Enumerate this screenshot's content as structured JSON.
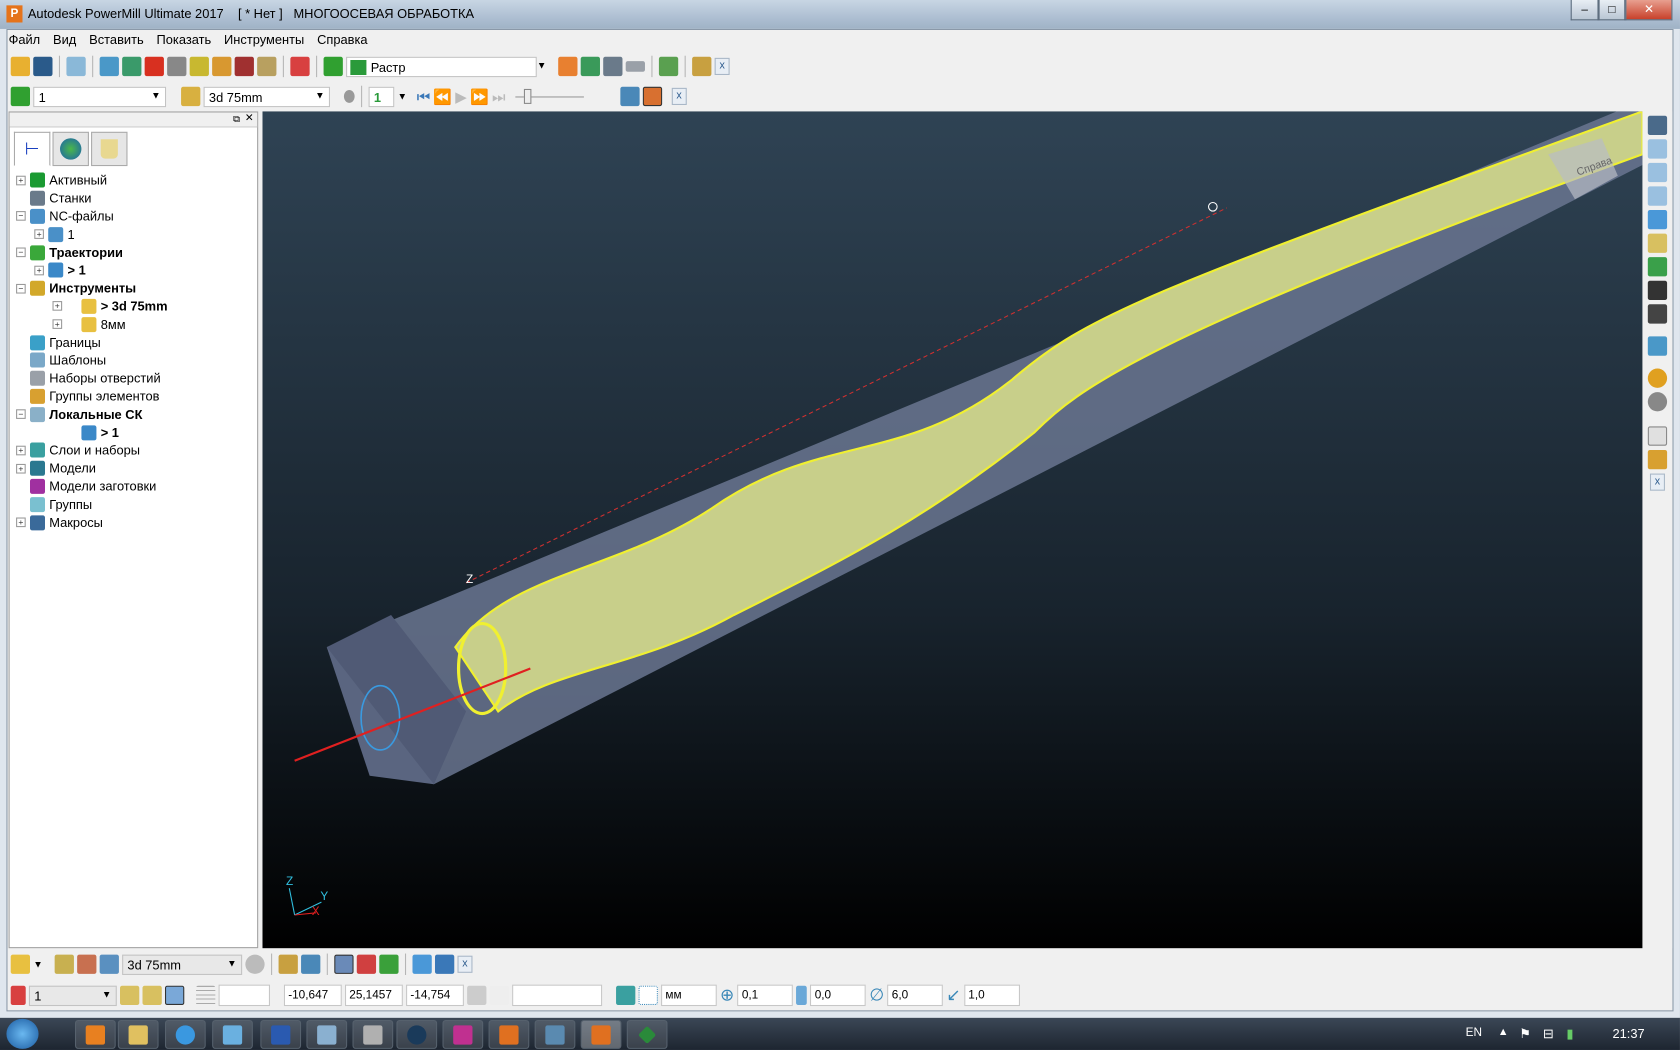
{
  "window": {
    "title": "Autodesk PowerMill Ultimate 2017",
    "project": "[ * Нет ]",
    "mode": "МНОГООСЕВАЯ ОБРАБОТКА"
  },
  "menu": [
    "Файл",
    "Вид",
    "Вставить",
    "Показать",
    "Инструменты",
    "Справка"
  ],
  "toolbar1": {
    "strategy_combo": "Растр"
  },
  "toolbar2": {
    "toolpath_combo": "1",
    "tool_combo": "3d 75mm",
    "step_value": "1"
  },
  "tree": [
    {
      "label": "Активный",
      "bold": false,
      "level": 0,
      "pm": "+",
      "color": "#1a9a32"
    },
    {
      "label": "Станки",
      "bold": false,
      "level": 0,
      "pm": "",
      "color": "#6a7a8a"
    },
    {
      "label": "NC-файлы",
      "bold": false,
      "level": 0,
      "pm": "-",
      "color": "#4a90c8"
    },
    {
      "label": "1",
      "bold": false,
      "level": 1,
      "pm": "+",
      "color": "#4a90c8"
    },
    {
      "label": "Траектории",
      "bold": true,
      "level": 0,
      "pm": "-",
      "color": "#3aa83a"
    },
    {
      "label": "> 1",
      "bold": true,
      "level": 1,
      "pm": "+",
      "color": "#3a88c8"
    },
    {
      "label": "Инструменты",
      "bold": true,
      "level": 0,
      "pm": "-",
      "color": "#d2a82a"
    },
    {
      "label": "> 3d 75mm",
      "bold": true,
      "level": 2,
      "pm": "+",
      "color": "#e8c040"
    },
    {
      "label": "8мм",
      "bold": false,
      "level": 2,
      "pm": "+",
      "color": "#e8c040"
    },
    {
      "label": "Границы",
      "bold": false,
      "level": 0,
      "pm": "",
      "color": "#3aa0c8"
    },
    {
      "label": "Шаблоны",
      "bold": false,
      "level": 0,
      "pm": "",
      "color": "#7aa8c8"
    },
    {
      "label": "Наборы отверстий",
      "bold": false,
      "level": 0,
      "pm": "",
      "color": "#9aa0a8"
    },
    {
      "label": "Группы элементов",
      "bold": false,
      "level": 0,
      "pm": "",
      "color": "#d8a030"
    },
    {
      "label": "Локальные СК",
      "bold": true,
      "level": 0,
      "pm": "-",
      "color": "#8ab0c8"
    },
    {
      "label": "> 1",
      "bold": true,
      "level": 2,
      "pm": "",
      "color": "#3a88c8"
    },
    {
      "label": "Слои и наборы",
      "bold": false,
      "level": 0,
      "pm": "+",
      "color": "#3aa0a0"
    },
    {
      "label": "Модели",
      "bold": false,
      "level": 0,
      "pm": "+",
      "color": "#2a7890"
    },
    {
      "label": "Модели заготовки",
      "bold": false,
      "level": 0,
      "pm": "",
      "color": "#a030a0"
    },
    {
      "label": "Группы",
      "bold": false,
      "level": 0,
      "pm": "",
      "color": "#7ac0d0"
    },
    {
      "label": "Макросы",
      "bold": false,
      "level": 0,
      "pm": "+",
      "color": "#3a6a9a"
    }
  ],
  "viewport": {
    "viewcube_label": "Справа",
    "axis_z": "Z",
    "axis_y": "Y",
    "axis_x": "X"
  },
  "bottom1": {
    "tool_combo": "3d 75mm"
  },
  "bottom2": {
    "workplane_combo": "1",
    "x": "-10,647",
    "y": "25,1457",
    "z": "-14,754",
    "units": "мм",
    "tolerance": "0,1",
    "stock": "0,0",
    "diameter": "6,0",
    "stepover": "1,0"
  },
  "taskbar": {
    "lang": "EN",
    "time": "21:37"
  }
}
